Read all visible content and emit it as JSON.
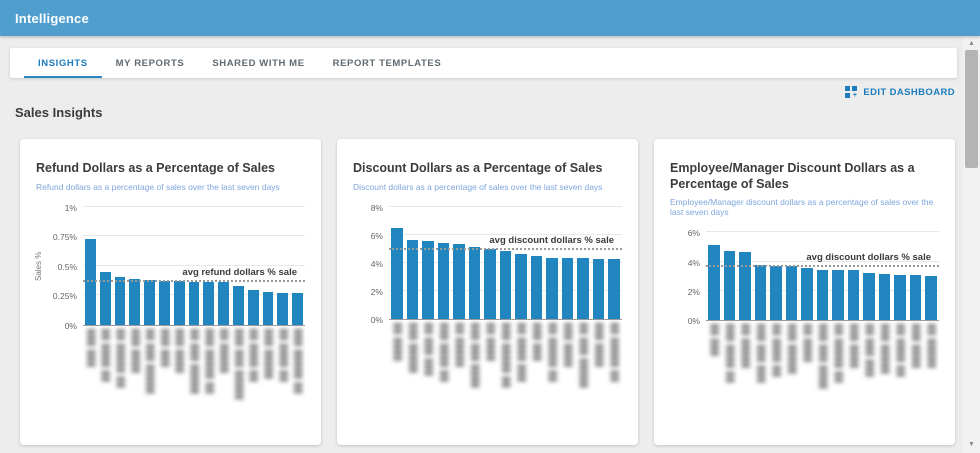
{
  "header": {
    "title": "Intelligence"
  },
  "tabs": [
    {
      "label": "INSIGHTS",
      "active": true
    },
    {
      "label": "MY REPORTS",
      "active": false
    },
    {
      "label": "SHARED WITH ME",
      "active": false
    },
    {
      "label": "REPORT TEMPLATES",
      "active": false
    }
  ],
  "toolbar": {
    "edit_dashboard_label": "EDIT DASHBOARD"
  },
  "section": {
    "title": "Sales Insights"
  },
  "colors": {
    "appbar_bg": "#4f9ecd",
    "accent_blue": "#1c7cbd",
    "bar_blue": "#2186c0",
    "subtitle_blue": "#7fa6dc",
    "page_bg": "#ededed"
  },
  "chart_data": [
    {
      "type": "bar",
      "title": "Refund Dollars as a Percentage of Sales",
      "subtitle": "Refund dollars as a percentage of sales over the last seven days",
      "ylabel": "Sales %",
      "ylim": [
        0,
        1
      ],
      "yticks": [
        {
          "label": "1%",
          "value": 1
        },
        {
          "label": "0.75%",
          "value": 0.75
        },
        {
          "label": "0.5%",
          "value": 0.5
        },
        {
          "label": "0.25%",
          "value": 0.25
        },
        {
          "label": "0%",
          "value": 0
        }
      ],
      "values": [
        0.73,
        0.45,
        0.4,
        0.39,
        0.38,
        0.37,
        0.37,
        0.36,
        0.36,
        0.36,
        0.33,
        0.29,
        0.28,
        0.27,
        0.27
      ],
      "avg_line": {
        "label": "avg refund dollars % sale",
        "value": 0.36
      },
      "x_labels_redacted": true,
      "x_label_masks": [
        "███ ███",
        "██ ████ ██",
        "██ █████ ██",
        "███ ████",
        "██ ███ █████",
        "███ ███",
        "███ ████",
        "██ ███ █████",
        "███ █████ ██",
        "██ █████",
        "███ ███ █████",
        "██ ████ ██",
        "███ █████",
        "██ ████ ██",
        "███ █████ ██"
      ]
    },
    {
      "type": "bar",
      "title": "Discount Dollars as a Percentage of Sales",
      "subtitle": "Discount dollars as a percentage of sales over the last seven days",
      "ylabel": "",
      "ylim": [
        0,
        8
      ],
      "yticks": [
        {
          "label": "8%",
          "value": 8
        },
        {
          "label": "6%",
          "value": 6
        },
        {
          "label": "4%",
          "value": 4
        },
        {
          "label": "2%",
          "value": 2
        },
        {
          "label": "0%",
          "value": 0
        }
      ],
      "values": [
        6.5,
        5.6,
        5.55,
        5.4,
        5.3,
        5.15,
        5.0,
        4.8,
        4.65,
        4.5,
        4.35,
        4.35,
        4.3,
        4.25,
        4.25
      ],
      "avg_line": {
        "label": "avg discount dollars % sale",
        "value": 4.9
      },
      "x_labels_redacted": true,
      "x_label_masks": [
        "██ ████",
        "███ █████",
        "██ ███ ███",
        "███ ████ ██",
        "██ █████",
        "███ ███ ████",
        "██ ████",
        "███ █████ ██",
        "██ ████ ███",
        "███ ███",
        "██ █████ ██",
        "███ ████",
        "██ ███ █████",
        "███ ████",
        "██ █████ ██"
      ]
    },
    {
      "type": "bar",
      "title": "Employee/Manager Discount Dollars as a Percentage of Sales",
      "subtitle": "Employee/Manager discount dollars as a percentage of sales over the last seven days",
      "ylabel": "",
      "ylim": [
        0,
        6
      ],
      "yticks": [
        {
          "label": "6%",
          "value": 6
        },
        {
          "label": "4%",
          "value": 4
        },
        {
          "label": "2%",
          "value": 2
        },
        {
          "label": "0%",
          "value": 0
        }
      ],
      "values": [
        5.1,
        4.7,
        4.65,
        3.75,
        3.7,
        3.7,
        3.55,
        3.4,
        3.4,
        3.4,
        3.25,
        3.15,
        3.1,
        3.1,
        3.0
      ],
      "avg_line": {
        "label": "avg discount dollars % sale",
        "value": 3.65
      },
      "x_labels_redacted": true,
      "x_label_masks": [
        "██ ███",
        "███ ████ ██",
        "██ █████",
        "███ ███ ███",
        "██ ████ ██",
        "███ █████",
        "██ ████",
        "███ ███ ████",
        "██ █████ ██",
        "███ ████",
        "██ ███ ███",
        "███ █████",
        "██ ████ ██",
        "███ ████",
        "██ █████"
      ]
    }
  ]
}
